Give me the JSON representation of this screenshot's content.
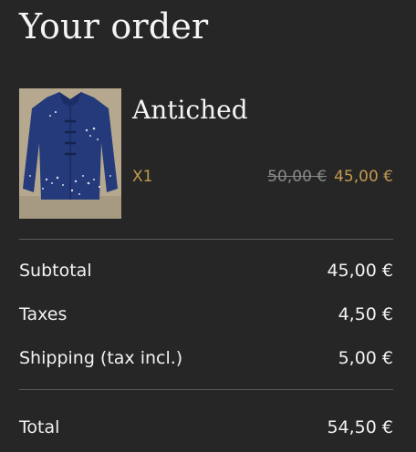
{
  "header": {
    "title": "Your order"
  },
  "item": {
    "name": "Antiched",
    "quantity": "X1",
    "original_price": "50,00 €",
    "sale_price": "45,00 €",
    "image_icon": "jacket-photo"
  },
  "summary": {
    "subtotal_label": "Subtotal",
    "subtotal_value": "45,00 €",
    "taxes_label": "Taxes",
    "taxes_value": "4,50 €",
    "shipping_label": "Shipping (tax incl.)",
    "shipping_value": "5,00 €",
    "total_label": "Total",
    "total_value": "54,50 €"
  },
  "colors": {
    "background": "#262626",
    "accent": "#c49a52",
    "muted": "#8a8a8a",
    "divider": "#5a5a5a"
  }
}
